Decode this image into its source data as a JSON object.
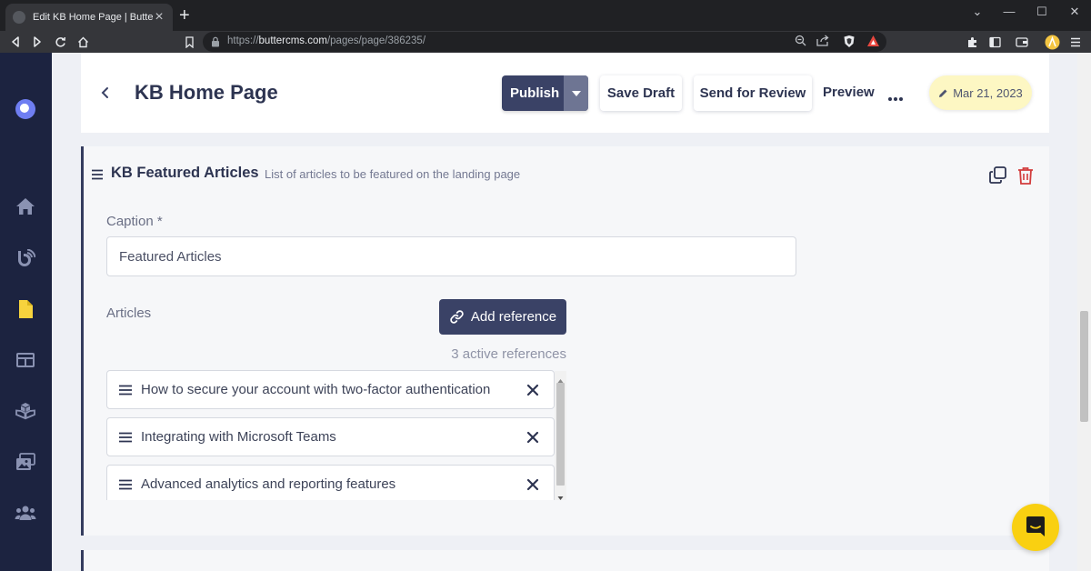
{
  "browser": {
    "tab_title": "Edit KB Home Page | ButterCMS",
    "tab_close": "×",
    "new_tab": "+",
    "url_scheme": "https://",
    "url_host": "buttercms.com",
    "url_path": "/pages/page/386235/",
    "window_buttons": [
      "⌄",
      "—",
      "☐",
      "✕"
    ]
  },
  "sidebar": {
    "items": [
      "home-icon",
      "blog-icon",
      "pages-icon",
      "content-types-icon",
      "collections-icon",
      "media-icon",
      "users-icon"
    ],
    "active_item": "pages-icon",
    "accent_color": "#f7d33d"
  },
  "header": {
    "title": "KB Home Page",
    "publish_label": "Publish",
    "save_draft_label": "Save Draft",
    "send_review_label": "Send for Review",
    "preview_label": "Preview",
    "date_label": "Mar 21, 2023"
  },
  "section": {
    "title": "KB Featured Articles",
    "description": "List of articles to be featured on the landing page",
    "caption_label": "Caption *",
    "caption_value": "Featured Articles",
    "articles_label": "Articles",
    "add_reference_label": "Add reference",
    "active_references": "3 active references",
    "references": [
      {
        "title": "How to secure your account with two-factor authentication"
      },
      {
        "title": "Integrating with Microsoft Teams"
      },
      {
        "title": "Advanced analytics and reporting features"
      }
    ]
  },
  "colors": {
    "primary": "#3a4266",
    "sidebar_bg": "#1c2340",
    "date_pill_bg": "#fdf7c3",
    "delete_red": "#d23c3c",
    "chat_yellow": "#f9d011"
  }
}
